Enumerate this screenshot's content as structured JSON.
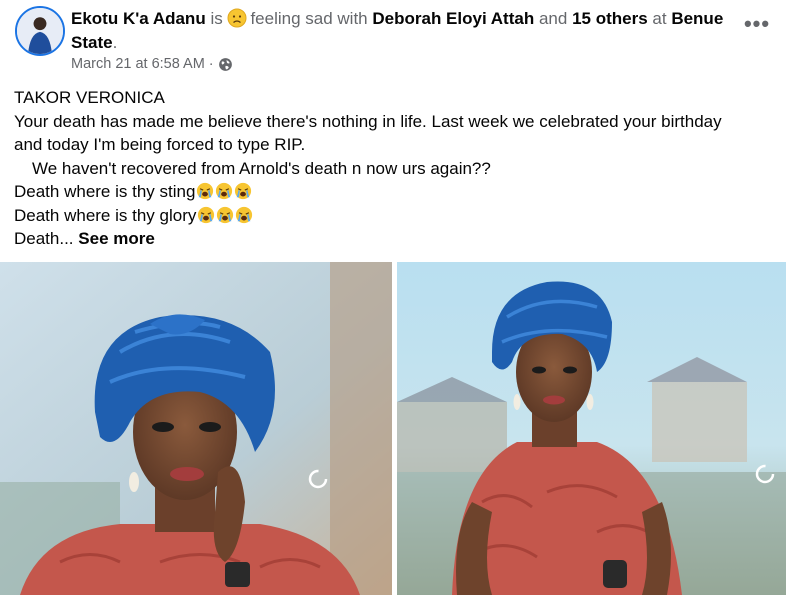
{
  "post": {
    "author": "Ekotu K'a Adanu",
    "is_text": "is",
    "feeling_icon": "sad-face-emoji",
    "feeling_text": "feeling sad with",
    "tagged": "Deborah Eloyi Attah",
    "and_text": "and",
    "others": "15 others",
    "at_text": "at",
    "location": "Benue State",
    "location_suffix": ".",
    "timestamp": "March 21 at 6:58 AM",
    "separator": "·",
    "privacy_icon": "globe-icon",
    "more_icon": "more-options-icon",
    "more_label": "•••"
  },
  "content": {
    "line1": "TAKOR VERONICA",
    "line2": "Your death has made me believe there's nothing in life. Last week we celebrated your birthday",
    "line3": "and today I'm being forced to type RIP.",
    "line4": "We haven't recovered from Arnold's death n now urs again??",
    "line5": "Death where is thy sting",
    "line6": "Death where is thy glory",
    "line7": "Death...",
    "see_more": "See more",
    "emoji": "loudly-crying-face-emoji"
  },
  "photos": [
    {
      "name": "photo-left",
      "icon": "loading-spinner-icon"
    },
    {
      "name": "photo-right",
      "icon": "loading-spinner-icon"
    }
  ],
  "colors": {
    "text": "#050505",
    "muted": "#65676b",
    "accent": "#1b74e4",
    "gele_blue": "#1f5fb0",
    "dress_red": "#c4574c"
  }
}
